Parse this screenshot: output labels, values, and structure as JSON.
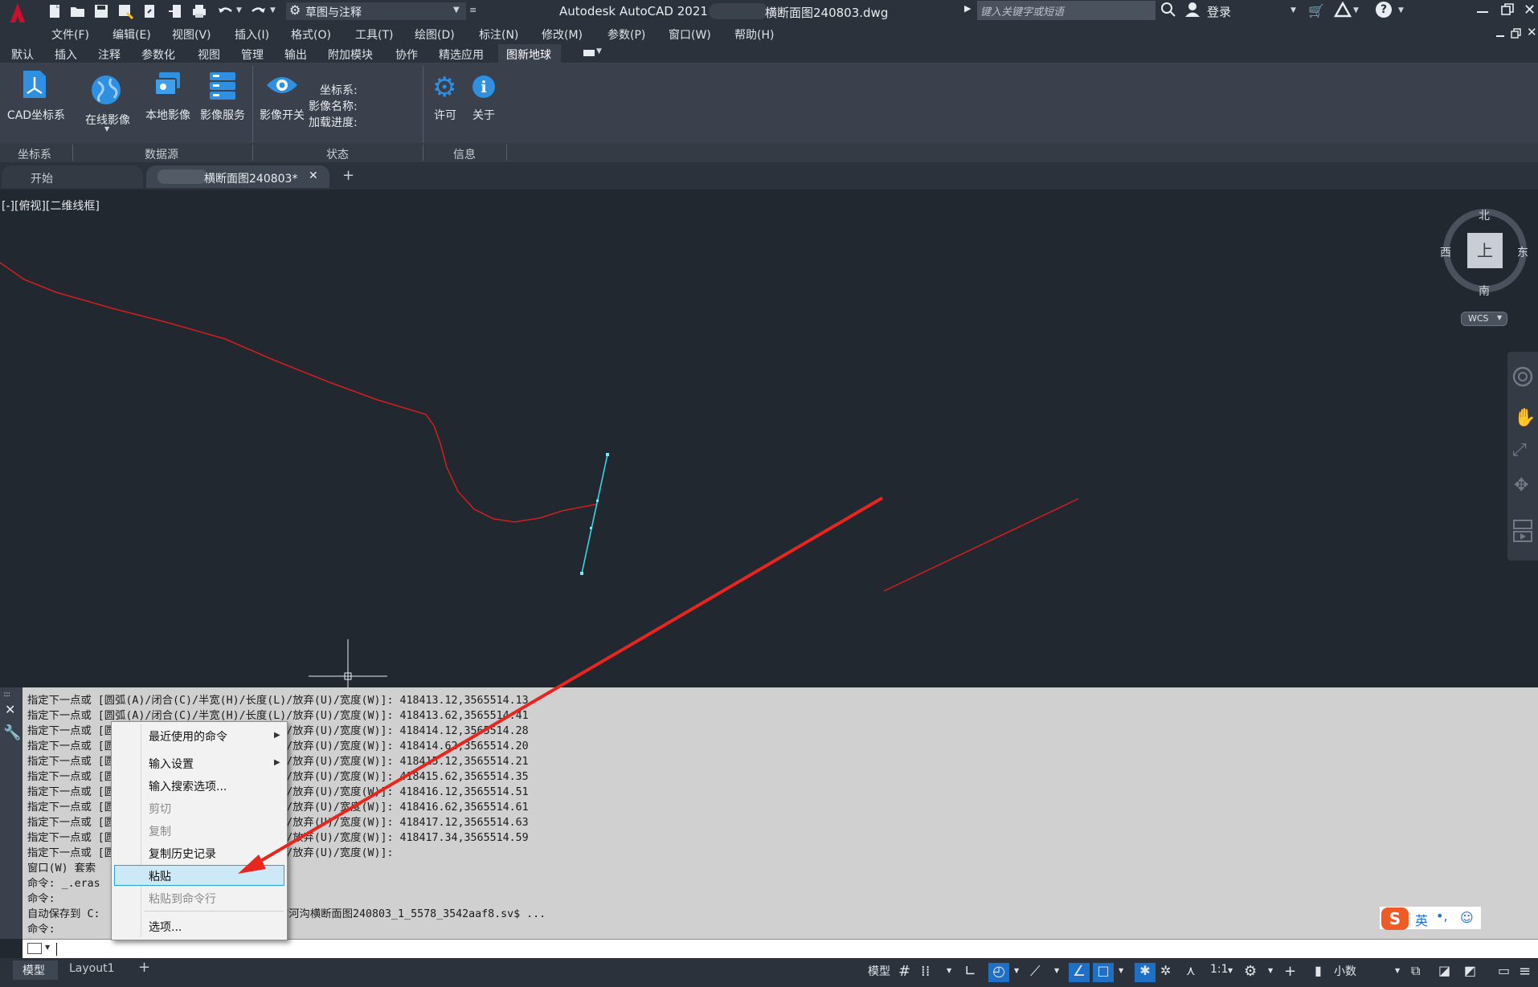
{
  "app": {
    "title": "Autodesk AutoCAD 2021",
    "filename": "横断面图240803.dwg",
    "logo_letter": "A",
    "workspace": "草图与注释",
    "search_placeholder": "键入关键字或短语",
    "login": "登录"
  },
  "menu": [
    "文件(F)",
    "编辑(E)",
    "视图(V)",
    "插入(I)",
    "格式(O)",
    "工具(T)",
    "绘图(D)",
    "标注(N)",
    "修改(M)",
    "参数(P)",
    "窗口(W)",
    "帮助(H)"
  ],
  "ribbon_tabs": [
    "默认",
    "插入",
    "注释",
    "参数化",
    "视图",
    "管理",
    "输出",
    "附加模块",
    "协作",
    "精选应用",
    "图新地球"
  ],
  "active_ribbon_tab": "图新地球",
  "ribbon": {
    "cad_coord": "CAD坐标系",
    "online_imagery": "在线影像",
    "local_imagery": "本地影像",
    "imagery_service": "影像服务",
    "imagery_switch": "影像开关",
    "status_coord": "坐标系:",
    "status_name": "影像名称:",
    "status_progress": "加载进度:",
    "license": "许可",
    "about": "关于",
    "panel_coord": "坐标系",
    "panel_datasource": "数据源",
    "panel_status": "状态",
    "panel_info": "信息"
  },
  "doc_tabs": {
    "start": "开始",
    "file": "横断面图240803*",
    "close": "✕",
    "add": "+"
  },
  "viewport": {
    "label": "[-][俯视][二维线框]",
    "compass": {
      "n": "北",
      "s": "南",
      "e": "东",
      "w": "西",
      "top": "上"
    },
    "wcs": "WCS"
  },
  "command_history": [
    "指定下一点或 [圆弧(A)/闭合(C)/半宽(H)/长度(L)/放弃(U)/宽度(W)]: 418413.12,3565514.13",
    "指定下一点或 [圆弧(A)/闭合(C)/半宽(H)/长度(L)/放弃(U)/宽度(W)]: 418413.62,3565514.41",
    "指定下一点或 [圆弧(A)/闭合(C)/半宽(H)/长度(L)/放弃(U)/宽度(W)]: 418414.12,3565514.28",
    "指定下一点或 [圆弧(A)/闭合(C)/半宽(H)/长度(L)/放弃(U)/宽度(W)]: 418414.62,3565514.20",
    "指定下一点或 [圆弧(A)/闭合(C)/半宽(H)/长度(L)/放弃(U)/宽度(W)]: 418415.12,3565514.21",
    "指定下一点或 [圆弧(A)/闭合(C)/半宽(H)/长度(L)/放弃(U)/宽度(W)]: 418415.62,3565514.35",
    "指定下一点或 [圆弧(A)/闭合(C)/半宽(H)/长度(L)/放弃(U)/宽度(W)]: 418416.12,3565514.51",
    "指定下一点或 [圆弧(A)/闭合(C)/半宽(H)/长度(L)/放弃(U)/宽度(W)]: 418416.62,3565514.61",
    "指定下一点或 [圆弧(A)/闭合(C)/半宽(H)/长度(L)/放弃(U)/宽度(W)]: 418417.12,3565514.63",
    "指定下一点或 [圆弧(A)/闭合(C)/半宽(H)/长度(L)/放弃(U)/宽度(W)]: 418417.34,3565514.59",
    "指定下一点或 [圆弧(A)/闭合(C)/半宽(H)/长度(L)/放弃(U)/宽度(W)]:",
    "窗口(W) 套索",
    "命令: _.eras",
    "命令:",
    "自动保存到 C:                  al\\Temp\\赖尔河沟横断面图240803_1_5578_3542aaf8.sv$ ...",
    "命令:"
  ],
  "context_menu": [
    {
      "label": "最近使用的命令",
      "submenu": true,
      "disabled": false
    },
    {
      "label": "输入设置",
      "submenu": true,
      "disabled": false
    },
    {
      "label": "输入搜索选项...",
      "submenu": false,
      "disabled": false
    },
    {
      "label": "剪切",
      "submenu": false,
      "disabled": true
    },
    {
      "label": "复制",
      "submenu": false,
      "disabled": true
    },
    {
      "label": "复制历史记录",
      "submenu": false,
      "disabled": false
    },
    {
      "label": "粘贴",
      "submenu": false,
      "disabled": false,
      "highlighted": true
    },
    {
      "label": "粘贴到命令行",
      "submenu": false,
      "disabled": true
    },
    {
      "label": "选项...",
      "submenu": false,
      "disabled": false
    }
  ],
  "ime": {
    "lang": "英",
    "punct": "•,"
  },
  "layout_tabs": {
    "model": "模型",
    "layout1": "Layout1",
    "add": "+"
  },
  "status": {
    "model": "模型",
    "scale": "1:1",
    "units": "小数"
  },
  "colors": {
    "accent": "#1e90ff",
    "polyline_red": "#d21e1e",
    "selected_cyan": "#35d6e6",
    "arrow_red": "#e8261e",
    "ctx_highlight": "#cde8f6"
  }
}
